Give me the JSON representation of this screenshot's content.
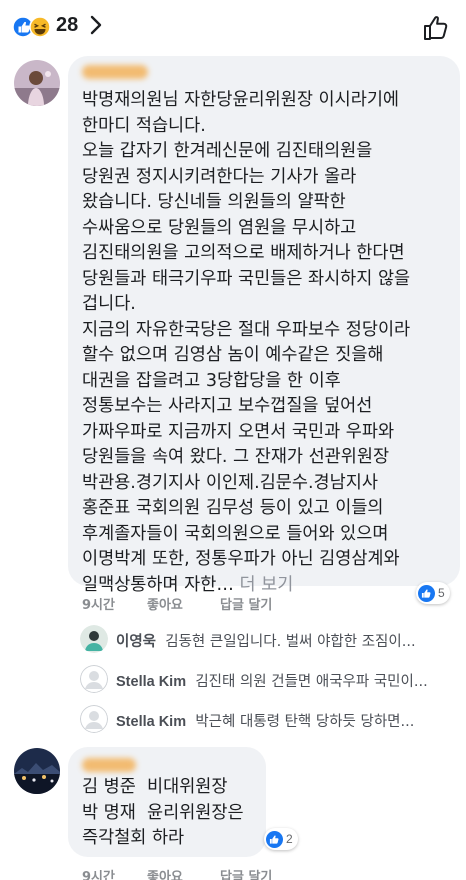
{
  "header": {
    "reaction_count": "28",
    "reaction_icons": [
      "like-icon",
      "haha-icon"
    ],
    "chevron": "chevron-right-icon",
    "like_button": "thumbs-up-icon"
  },
  "comment1": {
    "lines": [
      "박명재의원님 자한당윤리위원장 이시라기에",
      "한마디 적습니다.",
      "오늘 갑자기 한겨레신문에 김진태의원을",
      "당원권 정지시키려한다는 기사가 올라",
      "왔습니다. 당신네들 의원들의 얄팍한",
      "수싸움으로 당원들의 염원을 무시하고",
      "김진태의원을 고의적으로 배제하거나 한다면",
      "당원들과 태극기우파 국민들은 좌시하지 않을",
      "겁니다.",
      "지금의 자유한국당은 절대 우파보수 정당이라",
      "할수 없으며 김영삼 놈이 예수같은 짓을해",
      "대권을 잡을려고 3당합당을 한 이후",
      "정통보수는 사라지고 보수껍질을 덮어선",
      "가짜우파로 지금까지 오면서 국민과 우파와",
      "당원들을 속여 왔다. 그 잔재가 선관위원장",
      "박관용.경기지사 이인제.김문수.경남지사",
      "홍준표 국회의원 김무성 등이 있고 이들의",
      "후계졸자들이 국회의원으로 들어와 있으며",
      "이명박계 또한, 정통우파가 아닌 김영삼계와"
    ],
    "last_line": "일맥상통하며 자한…",
    "see_more": " 더 보기",
    "time": "9시간",
    "like_label": "좋아요",
    "reply_label": "답글 달기",
    "like_count": "5"
  },
  "replies": [
    {
      "name": "이영욱",
      "text": "김동현 큰일입니다. 벌써 야합한 조짐이..."
    },
    {
      "name": "Stella Kim",
      "text": "김진태 의원 건들면 애국우파 국민이..."
    },
    {
      "name": "Stella Kim",
      "text": "박근혜 대통령 탄핵 당하듯 당하면..."
    }
  ],
  "comment2": {
    "lines": [
      "김 병준  비대위원장",
      "박 명재  윤리위원장은",
      "즉각철회 하라"
    ],
    "like_count": "2",
    "time": "9시간",
    "like_label": "좋아요",
    "reply_label": "답글 달기"
  },
  "colors": {
    "bubble": "#f0f2f5",
    "meta": "#8a8d91",
    "like_blue": "#1877f2"
  }
}
